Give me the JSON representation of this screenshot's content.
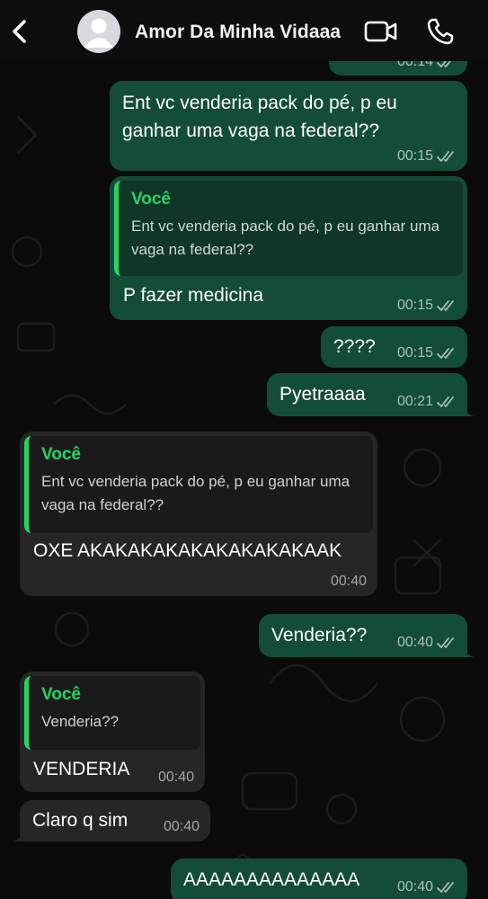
{
  "header": {
    "contact_name": "Amor Da Minha Vidaaa",
    "back_icon": "chevron-left-icon",
    "avatar_icon": "default-avatar-icon",
    "video_icon": "video-call-icon",
    "phone_icon": "phone-call-icon"
  },
  "colors": {
    "background": "#0b0b0b",
    "outgoing_bubble": "#144d37",
    "incoming_bubble": "#262626",
    "quote_accent": "#25d366"
  },
  "messages": [
    {
      "id": "m0",
      "direction": "out",
      "text": "",
      "time": "00:14",
      "read": true
    },
    {
      "id": "m1",
      "direction": "out",
      "text": "Ent vc venderia pack do pé, p eu ganhar uma vaga na federal??",
      "time": "00:15",
      "read": true
    },
    {
      "id": "m2",
      "direction": "out",
      "quote_author": "Você",
      "quote_text": "Ent vc venderia pack do pé, p eu ganhar uma vaga na federal??",
      "text": "P fazer medicina",
      "time": "00:15",
      "read": true
    },
    {
      "id": "m3",
      "direction": "out",
      "text": "????",
      "time": "00:15",
      "read": true
    },
    {
      "id": "m4",
      "direction": "out",
      "text": "Pyetraaaa",
      "time": "00:21",
      "read": true
    },
    {
      "id": "m5",
      "direction": "in",
      "quote_author": "Você",
      "quote_text": "Ent vc venderia pack do pé, p eu ganhar uma vaga na federal??",
      "text": "OXE AKAKAKAKAKAKAKAKAKAAK",
      "time": "00:40"
    },
    {
      "id": "m6",
      "direction": "out",
      "text": "Venderia??",
      "time": "00:40",
      "read": true
    },
    {
      "id": "m7",
      "direction": "in",
      "quote_author": "Você",
      "quote_text": "Venderia??",
      "text": "VENDERIA",
      "time": "00:40"
    },
    {
      "id": "m8",
      "direction": "in",
      "text": "Claro q sim",
      "time": "00:40"
    },
    {
      "id": "m9",
      "direction": "out",
      "text": "AAAAAAAAAAAAAA",
      "time": "00:40",
      "read": true
    }
  ]
}
